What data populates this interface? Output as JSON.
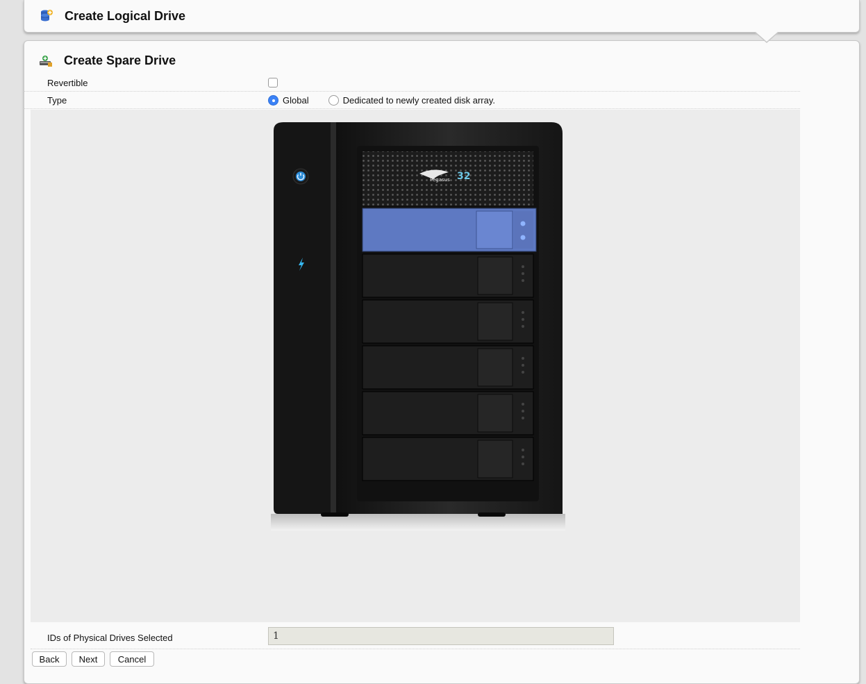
{
  "header": {
    "create_logical_drive": "Create Logical Drive"
  },
  "spare": {
    "title": "Create Spare Drive",
    "revertible_label": "Revertible",
    "revertible_checked": false,
    "type_label": "Type",
    "type_options": [
      "Global",
      "Dedicated to newly created disk array."
    ],
    "type_selected": "Global"
  },
  "enclosure": {
    "brand_text": "Pegasus",
    "brand_number": "32",
    "bay_count": 6,
    "selected_bay": 1
  },
  "ids": {
    "label": "IDs of Physical Drives Selected",
    "value": "1"
  },
  "buttons": {
    "back": "Back",
    "next": "Next",
    "cancel": "Cancel"
  },
  "colors": {
    "selected_bay": "#6079c2",
    "radio_on": "#3b82f6"
  }
}
